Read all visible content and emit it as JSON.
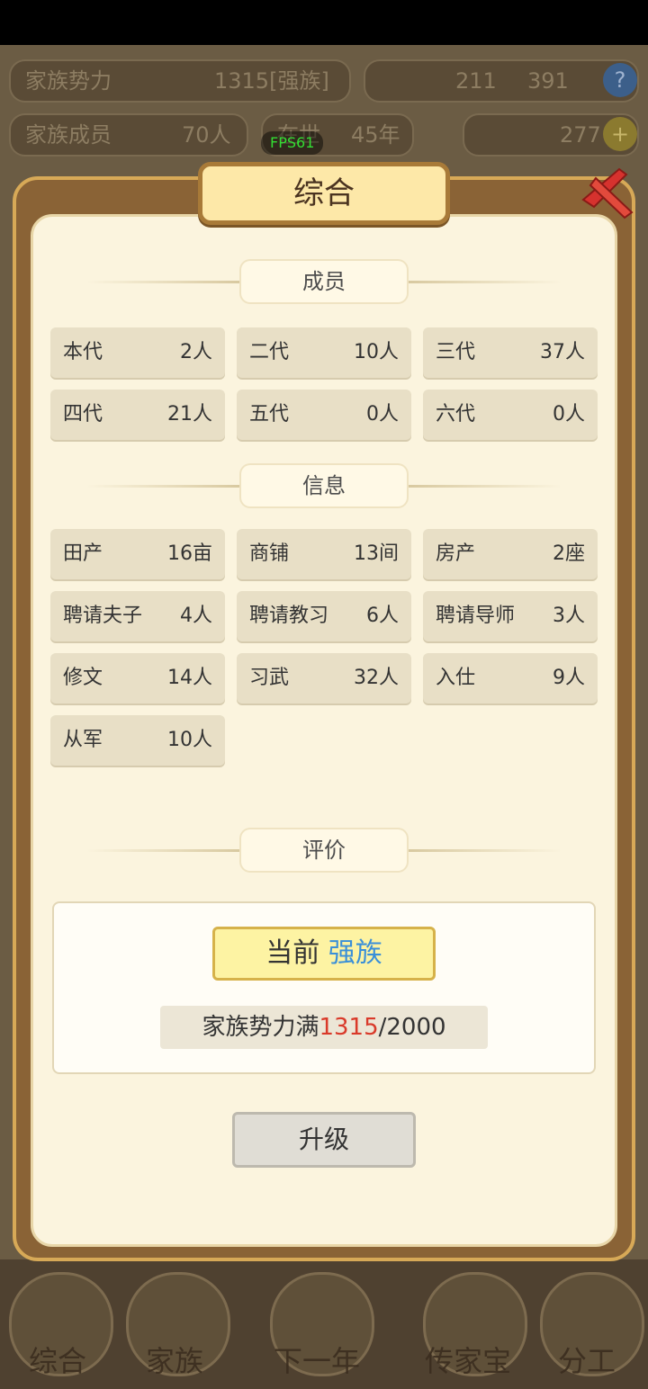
{
  "top_bar": {
    "power_label": "家族势力",
    "power_value": "1315",
    "power_tag": "[强族]",
    "coins": "211",
    "gems": "391",
    "members_label": "家族成员",
    "members_value": "70人",
    "reign_label": "在世",
    "reign_value": "45年",
    "gold": "277",
    "fps": "FPS61"
  },
  "dialog": {
    "title": "综合",
    "members_section": "成员",
    "members": [
      {
        "label": "本代",
        "value": "2人"
      },
      {
        "label": "二代",
        "value": "10人"
      },
      {
        "label": "三代",
        "value": "37人"
      },
      {
        "label": "四代",
        "value": "21人"
      },
      {
        "label": "五代",
        "value": "0人"
      },
      {
        "label": "六代",
        "value": "0人"
      }
    ],
    "info_section": "信息",
    "info": [
      {
        "label": "田产",
        "value": "16亩"
      },
      {
        "label": "商铺",
        "value": "13间"
      },
      {
        "label": "房产",
        "value": "2座"
      },
      {
        "label": "聘请夫子",
        "value": "4人"
      },
      {
        "label": "聘请教习",
        "value": "6人"
      },
      {
        "label": "聘请导师",
        "value": "3人"
      },
      {
        "label": "修文",
        "value": "14人"
      },
      {
        "label": "习武",
        "value": "32人"
      },
      {
        "label": "入仕",
        "value": "9人"
      },
      {
        "label": "从军",
        "value": "10人"
      }
    ],
    "eval_section": "评价",
    "rank_prefix": "当前",
    "rank": "强族",
    "progress_prefix": "家族势力满",
    "progress_current": "1315",
    "progress_max": "/2000",
    "upgrade_label": "升级"
  },
  "bottom_nav": [
    {
      "label": "综合"
    },
    {
      "label": "家族"
    },
    {
      "label": "下一年"
    },
    {
      "label": "传家宝"
    },
    {
      "label": "分工"
    }
  ],
  "colors": {
    "rank_color": "#3a8fd8",
    "progress_current_color": "#d93a2a"
  }
}
